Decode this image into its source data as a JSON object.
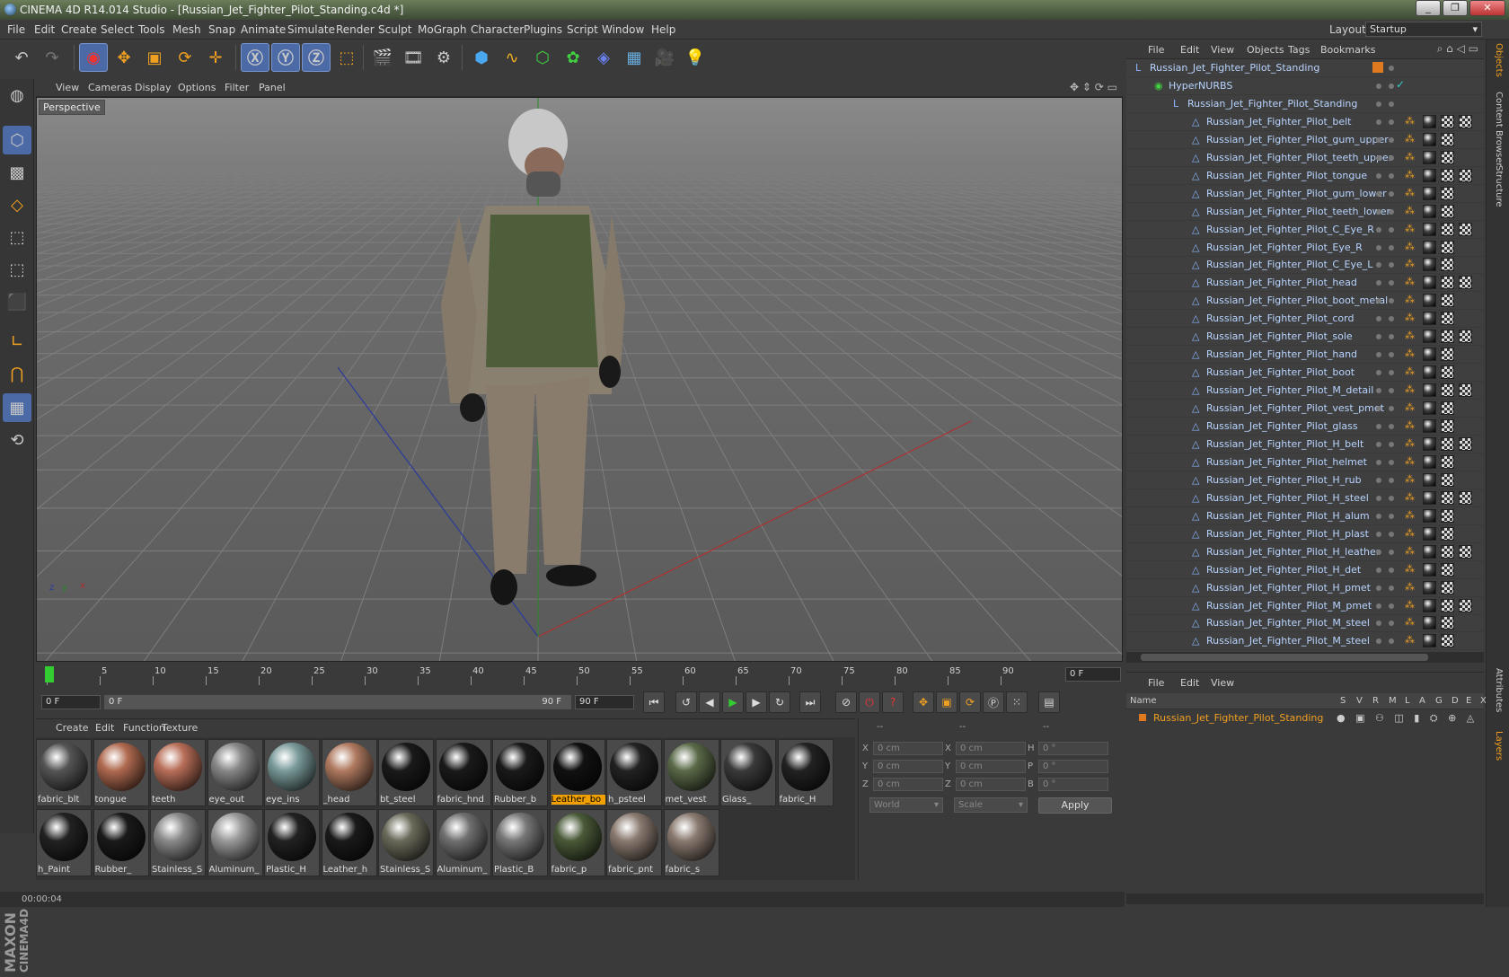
{
  "window": {
    "title": "CINEMA 4D R14.014 Studio - [Russian_Jet_Fighter_Pilot_Standing.c4d *]"
  },
  "menubar": [
    "File",
    "Edit",
    "Create",
    "Select",
    "Tools",
    "Mesh",
    "Snap",
    "Animate",
    "Simulate",
    "Render",
    "Sculpt",
    "MoGraph",
    "Character",
    "Plugins",
    "Script",
    "Window",
    "Help"
  ],
  "layout": {
    "label": "Layout:",
    "value": "Startup"
  },
  "viewport": {
    "menu": [
      "View",
      "Cameras",
      "Display",
      "Options",
      "Filter",
      "Panel"
    ],
    "label": "Perspective"
  },
  "timeline": {
    "ticks": [
      "0",
      "5",
      "10",
      "15",
      "20",
      "25",
      "30",
      "35",
      "40",
      "45",
      "50",
      "55",
      "60",
      "65",
      "70",
      "75",
      "80",
      "85",
      "90"
    ],
    "frame": "0 F"
  },
  "transport": {
    "start": "0 F",
    "range_start": "0 F",
    "range_end": "90 F",
    "end": "90 F"
  },
  "materials": {
    "menu": [
      "Create",
      "Edit",
      "Function",
      "Texture"
    ],
    "items": [
      {
        "label": "fabric_blt",
        "color": "#555555",
        "selected": false
      },
      {
        "label": "tongue",
        "color": "#b06a50",
        "selected": false
      },
      {
        "label": "teeth",
        "color": "#b86e58",
        "selected": false
      },
      {
        "label": "eye_out",
        "color": "#888888",
        "selected": false
      },
      {
        "label": "eye_ins",
        "color": "#7a9a9a",
        "selected": false
      },
      {
        "label": "_head",
        "color": "#b07a60",
        "selected": false
      },
      {
        "label": "bt_steel",
        "color": "#1a1a1a",
        "selected": false
      },
      {
        "label": "fabric_hnd",
        "color": "#1a1a1a",
        "selected": false
      },
      {
        "label": "Rubber_b",
        "color": "#1a1a1a",
        "selected": false
      },
      {
        "label": "Leather_bo",
        "color": "#111111",
        "selected": true
      },
      {
        "label": "h_psteel",
        "color": "#222222",
        "selected": false
      },
      {
        "label": "met_vest",
        "color": "#5a6a48",
        "selected": false
      },
      {
        "label": "Glass_",
        "color": "#3a3a3a",
        "selected": false
      },
      {
        "label": "fabric_H",
        "color": "#222222",
        "selected": false
      },
      {
        "label": "h_Paint",
        "color": "#222222",
        "selected": false
      },
      {
        "label": "Rubber_",
        "color": "#1a1a1a",
        "selected": false
      },
      {
        "label": "Stainless_S",
        "color": "#8a8a8a",
        "selected": false
      },
      {
        "label": "Aluminum_",
        "color": "#9a9a9a",
        "selected": false
      },
      {
        "label": "Plastic_H",
        "color": "#222222",
        "selected": false
      },
      {
        "label": "Leather_h",
        "color": "#1a1a1a",
        "selected": false
      },
      {
        "label": "Stainless_S",
        "color": "#6a6a5a",
        "selected": false
      },
      {
        "label": "Aluminum_",
        "color": "#707070",
        "selected": false
      },
      {
        "label": "Plastic_B",
        "color": "#777777",
        "selected": false
      },
      {
        "label": "fabric_p",
        "color": "#4a5a38",
        "selected": false
      },
      {
        "label": "fabric_pnt",
        "color": "#8a7a70",
        "selected": false
      },
      {
        "label": "fabric_s",
        "color": "#8a7a70",
        "selected": false
      }
    ]
  },
  "coords": {
    "header": [
      "--",
      "--",
      "--"
    ],
    "rows": [
      {
        "a": "X",
        "av": "0 cm",
        "b": "X",
        "bv": "0 cm",
        "c": "H",
        "cv": "0 °"
      },
      {
        "a": "Y",
        "av": "0 cm",
        "b": "Y",
        "bv": "0 cm",
        "c": "P",
        "cv": "0 °"
      },
      {
        "a": "Z",
        "av": "0 cm",
        "b": "Z",
        "bv": "0 cm",
        "c": "B",
        "cv": "0 °"
      }
    ],
    "world": "World",
    "scale": "Scale",
    "apply": "Apply"
  },
  "status": {
    "time": "00:00:04"
  },
  "objects": {
    "menu": [
      "File",
      "Edit",
      "View",
      "Objects",
      "Tags",
      "Bookmarks"
    ],
    "items": [
      {
        "name": "Russian_Jet_Fighter_Pilot_Standing",
        "indent": 0
      },
      {
        "name": "HyperNURBS",
        "indent": 1
      },
      {
        "name": "Russian_Jet_Fighter_Pilot_Standing",
        "indent": 2
      },
      {
        "name": "Russian_Jet_Fighter_Pilot_belt",
        "indent": 3
      },
      {
        "name": "Russian_Jet_Fighter_Pilot_gum_upper",
        "indent": 3
      },
      {
        "name": "Russian_Jet_Fighter_Pilot_teeth_upper",
        "indent": 3
      },
      {
        "name": "Russian_Jet_Fighter_Pilot_tongue",
        "indent": 3
      },
      {
        "name": "Russian_Jet_Fighter_Pilot_gum_lower",
        "indent": 3
      },
      {
        "name": "Russian_Jet_Fighter_Pilot_teeth_lower",
        "indent": 3
      },
      {
        "name": "Russian_Jet_Fighter_Pilot_C_Eye_R",
        "indent": 3
      },
      {
        "name": "Russian_Jet_Fighter_Pilot_Eye_R",
        "indent": 3
      },
      {
        "name": "Russian_Jet_Fighter_Pilot_C_Eye_L",
        "indent": 3
      },
      {
        "name": "Russian_Jet_Fighter_Pilot_head",
        "indent": 3
      },
      {
        "name": "Russian_Jet_Fighter_Pilot_boot_metal",
        "indent": 3
      },
      {
        "name": "Russian_Jet_Fighter_Pilot_cord",
        "indent": 3
      },
      {
        "name": "Russian_Jet_Fighter_Pilot_sole",
        "indent": 3
      },
      {
        "name": "Russian_Jet_Fighter_Pilot_hand",
        "indent": 3
      },
      {
        "name": "Russian_Jet_Fighter_Pilot_boot",
        "indent": 3
      },
      {
        "name": "Russian_Jet_Fighter_Pilot_M_detail",
        "indent": 3
      },
      {
        "name": "Russian_Jet_Fighter_Pilot_vest_pmet",
        "indent": 3
      },
      {
        "name": "Russian_Jet_Fighter_Pilot_glass",
        "indent": 3
      },
      {
        "name": "Russian_Jet_Fighter_Pilot_H_belt",
        "indent": 3
      },
      {
        "name": "Russian_Jet_Fighter_Pilot_helmet",
        "indent": 3
      },
      {
        "name": "Russian_Jet_Fighter_Pilot_H_rub",
        "indent": 3
      },
      {
        "name": "Russian_Jet_Fighter_Pilot_H_steel",
        "indent": 3
      },
      {
        "name": "Russian_Jet_Fighter_Pilot_H_alum",
        "indent": 3
      },
      {
        "name": "Russian_Jet_Fighter_Pilot_H_plast",
        "indent": 3
      },
      {
        "name": "Russian_Jet_Fighter_Pilot_H_leather",
        "indent": 3
      },
      {
        "name": "Russian_Jet_Fighter_Pilot_H_det",
        "indent": 3
      },
      {
        "name": "Russian_Jet_Fighter_Pilot_H_pmet",
        "indent": 3
      },
      {
        "name": "Russian_Jet_Fighter_Pilot_M_pmet",
        "indent": 3
      },
      {
        "name": "Russian_Jet_Fighter_Pilot_M_steel",
        "indent": 3
      },
      {
        "name": "Russian_Jet_Fighter_Pilot_M_steel",
        "indent": 3
      }
    ]
  },
  "layers": {
    "menu": [
      "File",
      "Edit",
      "View"
    ],
    "columns": [
      "Name",
      "S",
      "V",
      "R",
      "M",
      "L",
      "A",
      "G",
      "D",
      "E",
      "X"
    ],
    "row": "Russian_Jet_Fighter_Pilot_Standing"
  },
  "dock_tabs": [
    "Objects",
    "Content Browser",
    "Structure",
    "Attributes",
    "Layers"
  ],
  "colors": {
    "accent_orange": "#e07a20",
    "selection_blue": "#4b6aa6",
    "object_text": "#b8d4ff"
  }
}
